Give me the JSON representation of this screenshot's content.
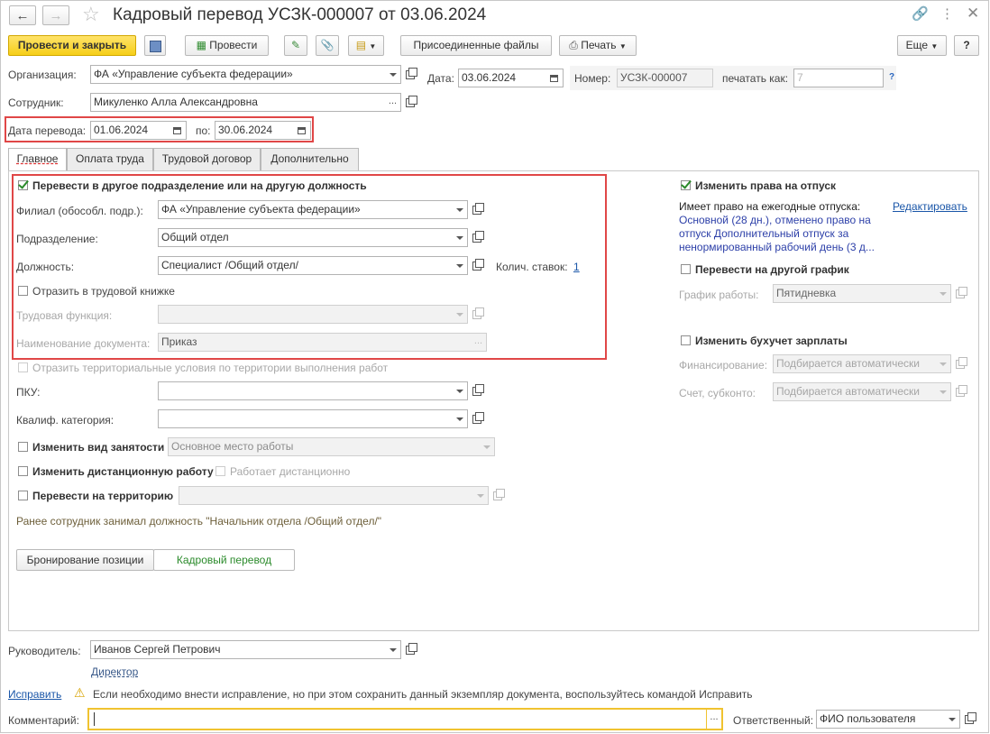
{
  "window": {
    "title": "Кадровый перевод УСЗК-000007 от 03.06.2024"
  },
  "toolbar": {
    "post_close": "Провести и закрыть",
    "post": "Провести",
    "attached_files": "Присоединенные файлы",
    "print": "Печать",
    "more": "Еще",
    "help": "?"
  },
  "header": {
    "org_label": "Организация:",
    "org_value": "ФА «Управление субъекта федерации»",
    "date_label": "Дата:",
    "date_value": "03.06.2024",
    "number_label": "Номер:",
    "number_value": "УСЗК-000007",
    "print_as_label": "печатать как:",
    "print_as_value": "7",
    "employee_label": "Сотрудник:",
    "employee_value": "Микуленко Алла Александровна",
    "transfer_date_label": "Дата перевода:",
    "transfer_date_value": "01.06.2024",
    "to_label": "по:",
    "to_value": "30.06.2024"
  },
  "tabs": [
    "Главное",
    "Оплата труда",
    "Трудовой договор",
    "Дополнительно"
  ],
  "main": {
    "transfer_check": "Перевести в другое подразделение или на другую должность",
    "branch_label": "Филиал (обособл. подр.):",
    "branch_value": "ФА «Управление субъекта федерации»",
    "dept_label": "Подразделение:",
    "dept_value": "Общий отдел",
    "position_label": "Должность:",
    "position_value": "Специалист /Общий отдел/",
    "rates_label": "Колич. ставок:",
    "rates_value": "1",
    "workbook_check": "Отразить в трудовой книжке",
    "labor_function_label": "Трудовая функция:",
    "doc_name_label": "Наименование документа:",
    "doc_name_value": "Приказ",
    "territorial_check": "Отразить территориальные условия по территории выполнения работ",
    "pku_label": "ПКУ:",
    "qual_label": "Квалиф. категория:",
    "employment_check": "Изменить вид занятости",
    "employment_value": "Основное место работы",
    "remote_check": "Изменить дистанционную работу",
    "remote_works": "Работает дистанционно",
    "territory_check": "Перевести на территорию",
    "previous_note": "Ранее сотрудник занимал должность \"Начальник отдела /Общий отдел/\"",
    "btn_reserve": "Бронирование позиции",
    "btn_transfer": "Кадровый перевод"
  },
  "right": {
    "vacation_check": "Изменить права на отпуск",
    "vacation_title": "Имеет право на ежегодные отпуска:",
    "edit_link": "Редактировать",
    "vacation_line1": "Основной (28 дн.), отменено право на",
    "vacation_line2": "отпуск Дополнительный отпуск за",
    "vacation_line3": "ненормированный рабочий день (3 д...",
    "schedule_check": "Перевести на другой график",
    "schedule_label": "График работы:",
    "schedule_value": "Пятидневка",
    "accounting_check": "Изменить бухучет зарплаты",
    "financing_label": "Финансирование:",
    "financing_value": "Подбирается автоматически",
    "account_label": "Счет, субконто:",
    "account_value": "Подбирается автоматически"
  },
  "footer": {
    "manager_label": "Руководитель:",
    "manager_value": "Иванов Сергей Петрович",
    "manager_position": "Директор",
    "fix_link": "Исправить",
    "fix_note": "Если необходимо внести исправление, но при этом сохранить данный экземпляр документа, воспользуйтесь командой Исправить",
    "comment_label": "Комментарий:",
    "responsible_label": "Ответственный:",
    "responsible_value": "ФИО пользователя"
  }
}
